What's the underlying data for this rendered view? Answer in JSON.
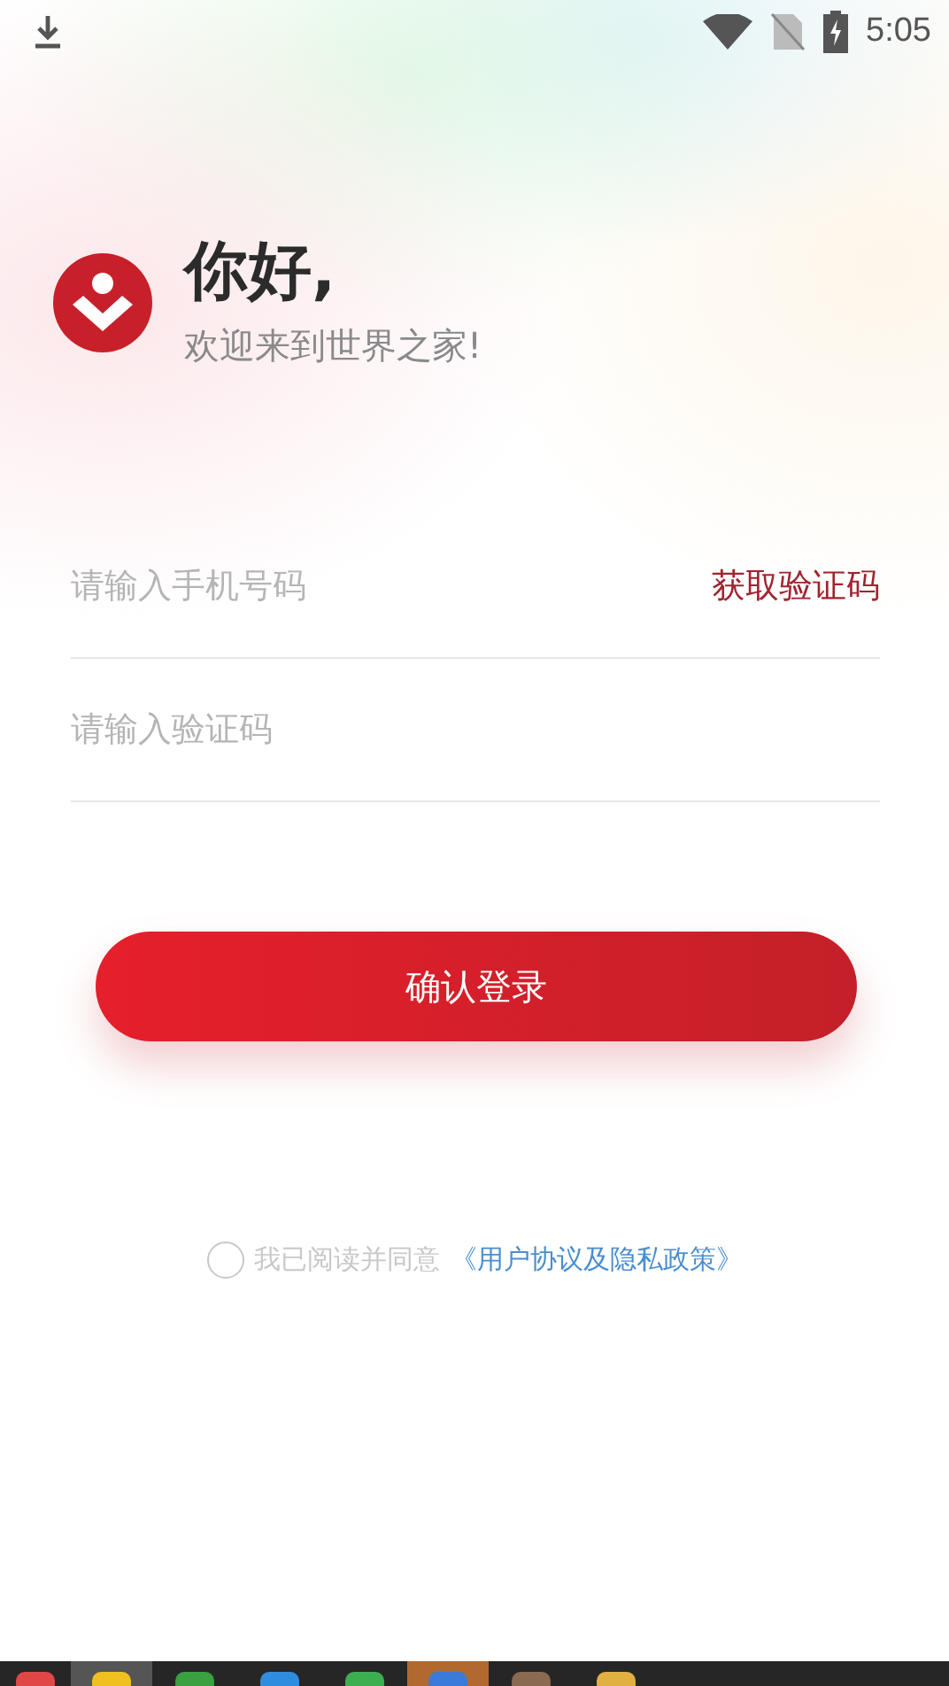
{
  "status_bar": {
    "time": "5:05"
  },
  "header": {
    "title": "你好,",
    "subtitle": "欢迎来到世界之家!"
  },
  "phone_field": {
    "placeholder": "请输入手机号码",
    "action": "获取验证码"
  },
  "code_field": {
    "placeholder": "请输入验证码"
  },
  "login_button": {
    "label": "确认登录"
  },
  "agreement": {
    "checked": false,
    "text": "我已阅读并同意",
    "link": "《用户协议及隐私政策》"
  }
}
